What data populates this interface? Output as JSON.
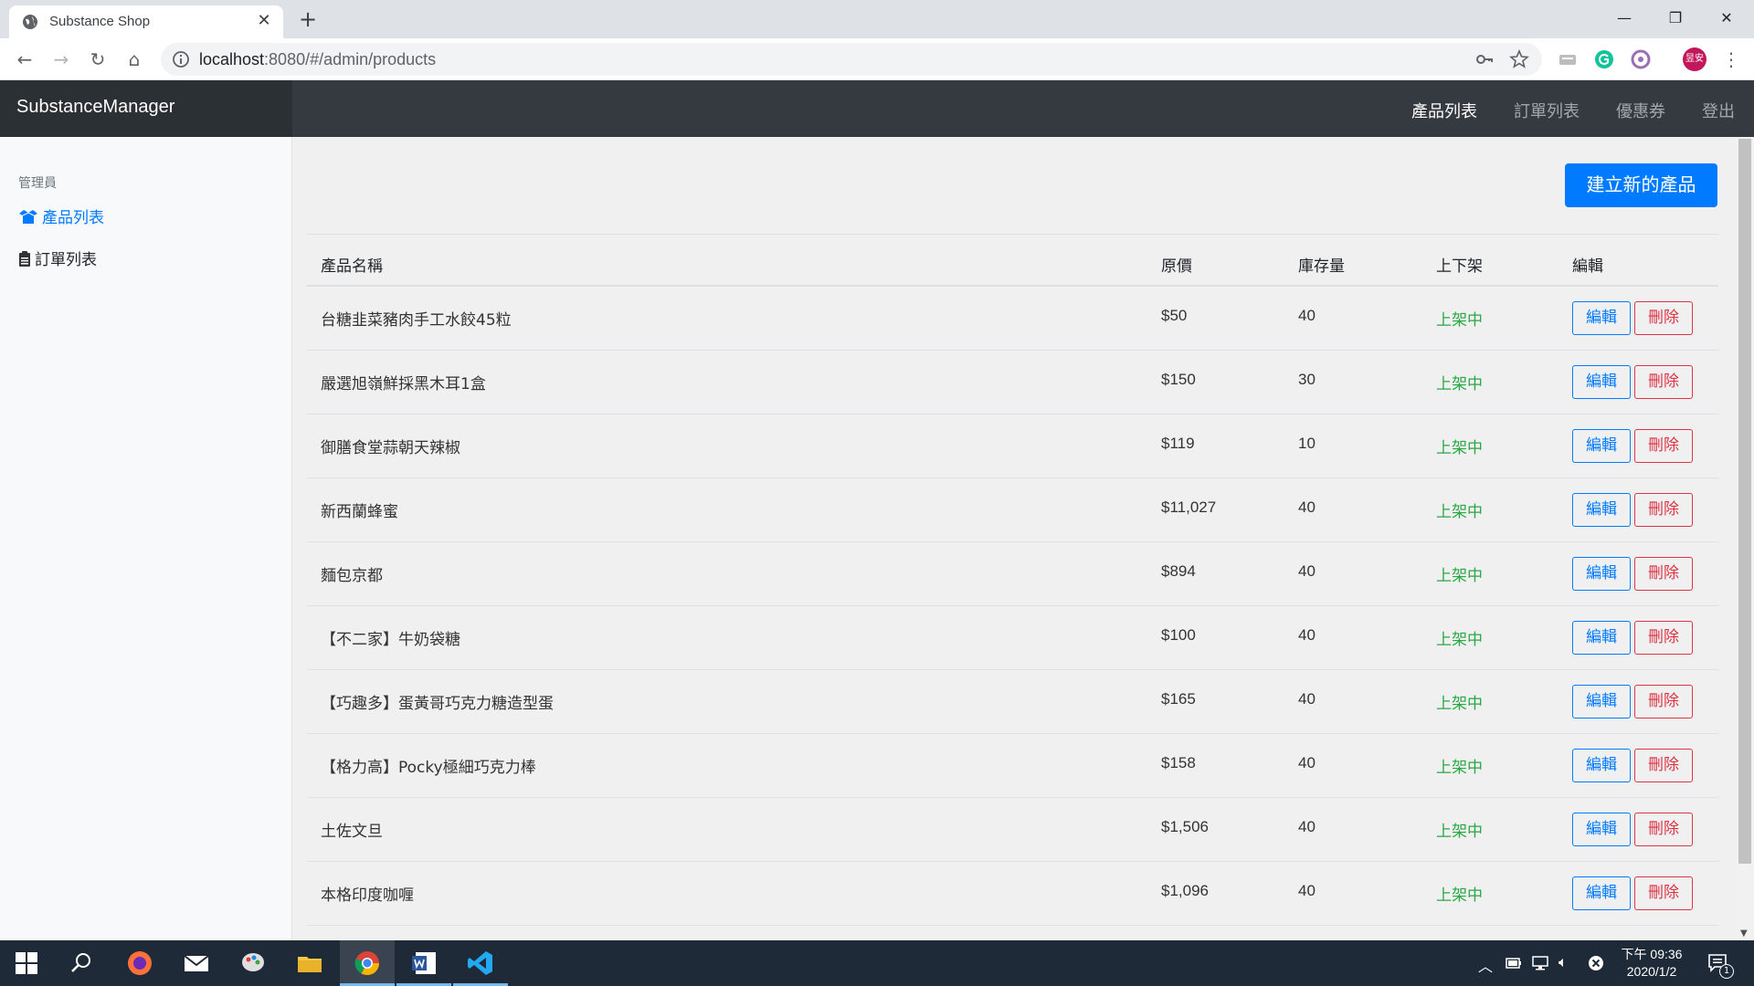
{
  "browser": {
    "tab_title": "Substance Shop",
    "url_host": "localhost",
    "url_path": ":8080/#/admin/products",
    "profile_label": "昱安"
  },
  "app": {
    "brand": "SubstanceManager",
    "topnav": [
      "產品列表",
      "訂單列表",
      "優惠券",
      "登出"
    ]
  },
  "sidebar": {
    "heading": "管理員",
    "items": [
      {
        "label": "產品列表",
        "icon": "box-open-icon"
      },
      {
        "label": "訂單列表",
        "icon": "clipboard-icon"
      }
    ]
  },
  "main": {
    "create_button": "建立新的產品",
    "columns": [
      "產品名稱",
      "原價",
      "庫存量",
      "上下架",
      "編輯"
    ],
    "edit_label": "編輯",
    "delete_label": "刪除",
    "rows": [
      {
        "name": "台糖韭菜豬肉手工水餃45粒",
        "price": "$50",
        "stock": "40",
        "status": "上架中"
      },
      {
        "name": "嚴選旭嶺鮮採黑木耳1盒",
        "price": "$150",
        "stock": "30",
        "status": "上架中"
      },
      {
        "name": "御膳食堂蒜朝天辣椒",
        "price": "$119",
        "stock": "10",
        "status": "上架中"
      },
      {
        "name": "新西蘭蜂蜜",
        "price": "$11,027",
        "stock": "40",
        "status": "上架中"
      },
      {
        "name": "麵包京都",
        "price": "$894",
        "stock": "40",
        "status": "上架中"
      },
      {
        "name": "【不二家】牛奶袋糖",
        "price": "$100",
        "stock": "40",
        "status": "上架中"
      },
      {
        "name": "【巧趣多】蛋黃哥巧克力糖造型蛋",
        "price": "$165",
        "stock": "40",
        "status": "上架中"
      },
      {
        "name": "【格力高】Pocky極細巧克力棒",
        "price": "$158",
        "stock": "40",
        "status": "上架中"
      },
      {
        "name": "土佐文旦",
        "price": "$1,506",
        "stock": "40",
        "status": "上架中"
      },
      {
        "name": "本格印度咖喱",
        "price": "$1,096",
        "stock": "40",
        "status": "上架中"
      }
    ]
  },
  "taskbar": {
    "time": "下午 09:36",
    "date": "2020/1/2",
    "notification_count": "1"
  },
  "colors": {
    "primary": "#007bff",
    "danger": "#dc3545",
    "success": "#28a745",
    "navbar": "#343a40"
  }
}
